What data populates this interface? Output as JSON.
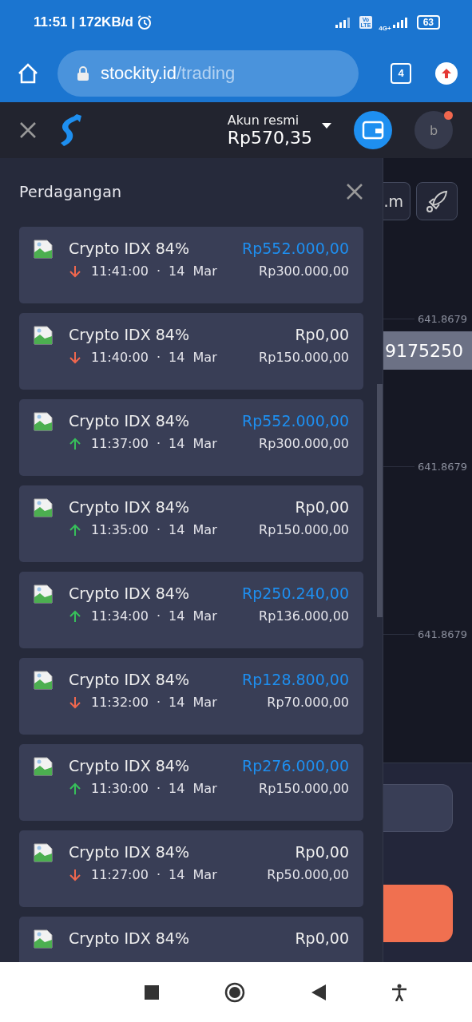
{
  "status_bar": {
    "time": "11:51 | 172KB/d",
    "volte": [
      "Vo",
      "LTE"
    ],
    "network": "4G+",
    "battery": "63"
  },
  "browser": {
    "url_host": "stockity.id",
    "url_path": "/trading",
    "tab_count": "4"
  },
  "header": {
    "account_label": "Akun resmi",
    "balance": "Rp570,35",
    "avatar": "b",
    "notification": true
  },
  "panel": {
    "title": "Perdagangan",
    "trades": [
      {
        "asset": "Crypto IDX 84%",
        "payout": "Rp552.000,00",
        "won": true,
        "rising": false,
        "when": "11:41:00 · 14 Mar",
        "amount": "Rp300.000,00"
      },
      {
        "asset": "Crypto IDX 84%",
        "payout": "Rp0,00",
        "won": false,
        "rising": false,
        "when": "11:40:00 · 14 Mar",
        "amount": "Rp150.000,00"
      },
      {
        "asset": "Crypto IDX 84%",
        "payout": "Rp552.000,00",
        "won": true,
        "rising": true,
        "when": "11:37:00 · 14 Mar",
        "amount": "Rp300.000,00"
      },
      {
        "asset": "Crypto IDX 84%",
        "payout": "Rp0,00",
        "won": false,
        "rising": true,
        "when": "11:35:00 · 14 Mar",
        "amount": "Rp150.000,00"
      },
      {
        "asset": "Crypto IDX 84%",
        "payout": "Rp250.240,00",
        "won": true,
        "rising": true,
        "when": "11:34:00 · 14 Mar",
        "amount": "Rp136.000,00"
      },
      {
        "asset": "Crypto IDX 84%",
        "payout": "Rp128.800,00",
        "won": true,
        "rising": false,
        "when": "11:32:00 · 14 Mar",
        "amount": "Rp70.000,00"
      },
      {
        "asset": "Crypto IDX 84%",
        "payout": "Rp276.000,00",
        "won": true,
        "rising": true,
        "when": "11:30:00 · 14 Mar",
        "amount": "Rp150.000,00"
      },
      {
        "asset": "Crypto IDX 84%",
        "payout": "Rp0,00",
        "won": false,
        "rising": false,
        "when": "11:27:00 · 14 Mar",
        "amount": "Rp50.000,00"
      },
      {
        "asset": "Crypto IDX 84%",
        "payout": "Rp0,00",
        "won": false
      }
    ]
  },
  "chart": {
    "tool_button": ".m",
    "price_labels": [
      "641.8679",
      "641.8679",
      "641.8679"
    ],
    "current_price": "9175250"
  }
}
